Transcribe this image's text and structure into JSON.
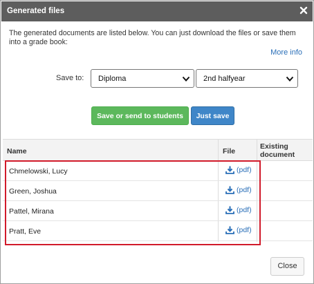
{
  "dialog": {
    "title": "Generated files",
    "description": "The generated documents are listed below. You can just download the files or save them into a grade book:",
    "more_info": "More info",
    "save_to_label": "Save to:",
    "save_to_value": "Diploma",
    "period_value": "2nd halfyear",
    "buttons": {
      "send": "Save or send to students",
      "save": "Just save",
      "close": "Close"
    },
    "table": {
      "headers": {
        "name": "Name",
        "file": "File",
        "existing": "Existing document"
      },
      "rows": [
        {
          "name": "Chmelowski, Lucy",
          "file": "(pdf)",
          "existing": ""
        },
        {
          "name": "Green, Joshua",
          "file": "(pdf)",
          "existing": ""
        },
        {
          "name": "Pattel, Mirana",
          "file": "(pdf)",
          "existing": ""
        },
        {
          "name": "Pratt, Eve",
          "file": "(pdf)",
          "existing": ""
        }
      ]
    }
  },
  "colors": {
    "titlebar": "#5d5d5d",
    "link": "#2a6fb8",
    "green_button": "#5cb85c",
    "blue_button": "#3f86c8",
    "highlight": "#d11a2a"
  }
}
